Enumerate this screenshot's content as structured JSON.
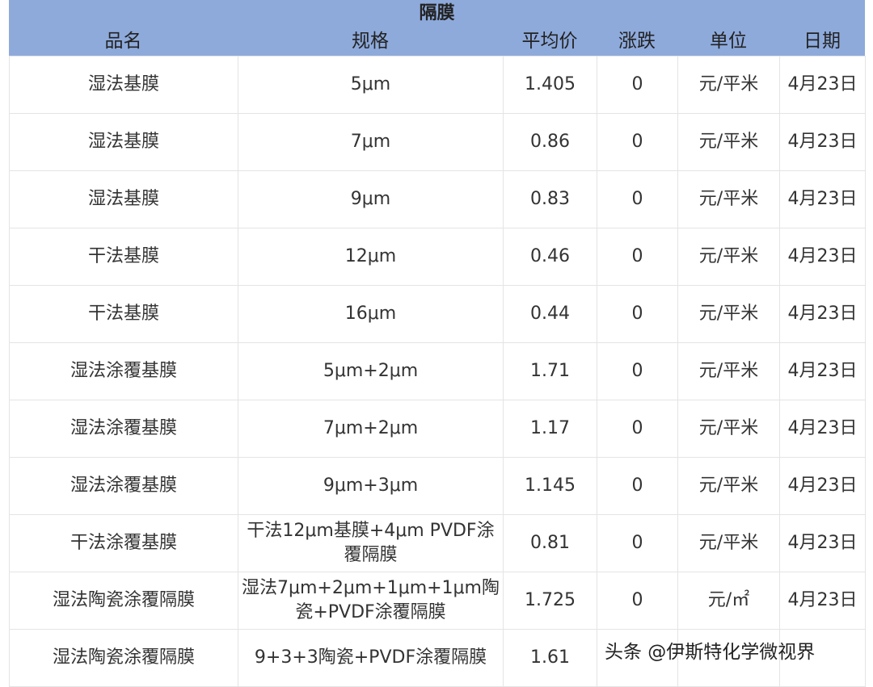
{
  "title": "隔膜",
  "columns": [
    "品名",
    "规格",
    "平均价",
    "涨跌",
    "单位",
    "日期"
  ],
  "rows": [
    {
      "name": "湿法基膜",
      "spec": "5μm",
      "price": "1.405",
      "change": "0",
      "unit": "元/平米",
      "date": "4月23日"
    },
    {
      "name": "湿法基膜",
      "spec": "7μm",
      "price": "0.86",
      "change": "0",
      "unit": "元/平米",
      "date": "4月23日"
    },
    {
      "name": "湿法基膜",
      "spec": "9μm",
      "price": "0.83",
      "change": "0",
      "unit": "元/平米",
      "date": "4月23日"
    },
    {
      "name": "干法基膜",
      "spec": "12μm",
      "price": "0.46",
      "change": "0",
      "unit": "元/平米",
      "date": "4月23日"
    },
    {
      "name": "干法基膜",
      "spec": "16μm",
      "price": "0.44",
      "change": "0",
      "unit": "元/平米",
      "date": "4月23日"
    },
    {
      "name": "湿法涂覆基膜",
      "spec": "5μm+2μm",
      "price": "1.71",
      "change": "0",
      "unit": "元/平米",
      "date": "4月23日"
    },
    {
      "name": "湿法涂覆基膜",
      "spec": "7μm+2μm",
      "price": "1.17",
      "change": "0",
      "unit": "元/平米",
      "date": "4月23日"
    },
    {
      "name": "湿法涂覆基膜",
      "spec": "9μm+3μm",
      "price": "1.145",
      "change": "0",
      "unit": "元/平米",
      "date": "4月23日"
    },
    {
      "name": "干法涂覆基膜",
      "spec": "干法12μm基膜+4μm PVDF涂覆隔膜",
      "price": "0.81",
      "change": "0",
      "unit": "元/平米",
      "date": "4月23日"
    },
    {
      "name": "湿法陶瓷涂覆隔膜",
      "spec": "湿法7μm+2μm+1μm+1μm陶瓷+PVDF涂覆隔膜",
      "price": "1.725",
      "change": "0",
      "unit": "元/㎡",
      "date": "4月23日"
    },
    {
      "name": "湿法陶瓷涂覆隔膜",
      "spec": "9+3+3陶瓷+PVDF涂覆隔膜",
      "price": "1.61",
      "change": "",
      "unit": "",
      "date": ""
    }
  ],
  "watermark": "头条 @伊斯特化学微视界",
  "colors": {
    "header_bg": "#8eaadb",
    "border": "#e4e4e4"
  }
}
